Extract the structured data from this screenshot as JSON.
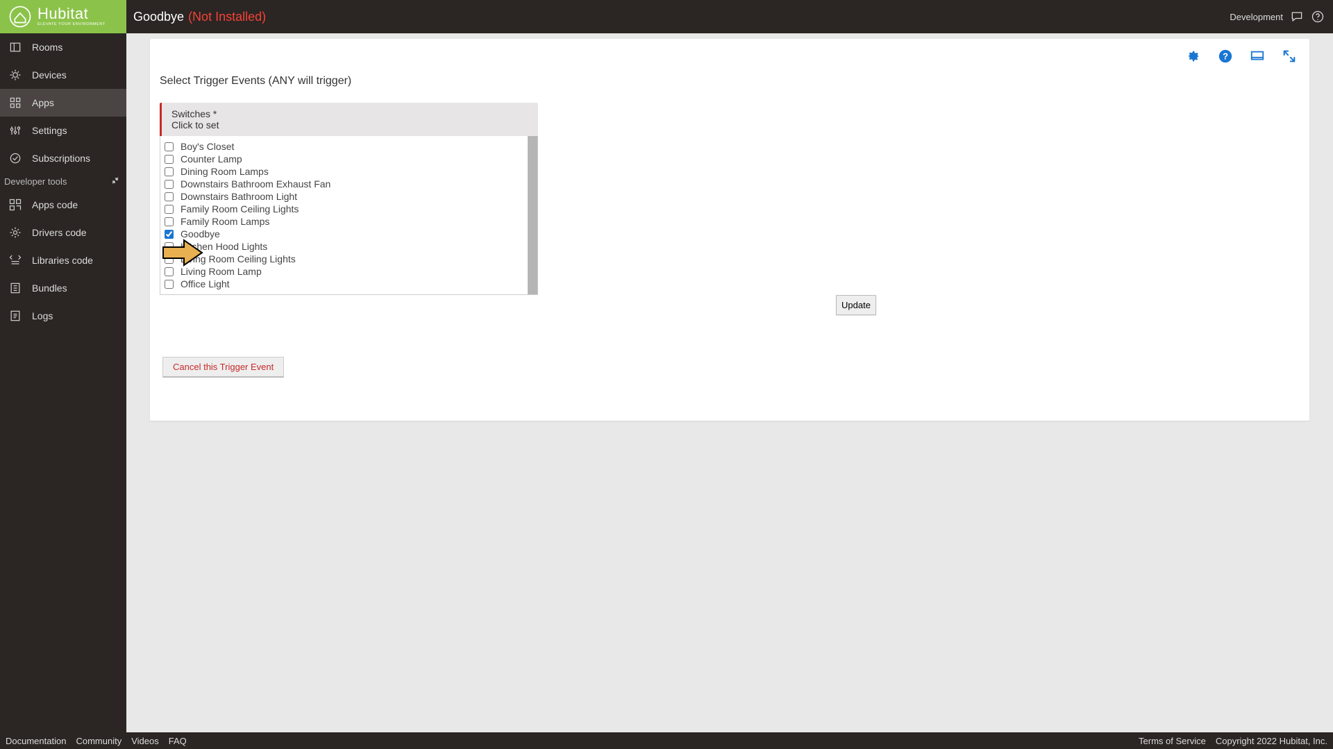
{
  "brand": {
    "name": "Hubitat",
    "tagline": "ELEVATE YOUR ENVIRONMENT"
  },
  "header": {
    "title": "Goodbye",
    "status": "(Not Installed)",
    "rightLabel": "Development"
  },
  "sidebar": {
    "items": [
      {
        "label": "Rooms"
      },
      {
        "label": "Devices"
      },
      {
        "label": "Apps"
      },
      {
        "label": "Settings"
      },
      {
        "label": "Subscriptions"
      }
    ],
    "devHeader": "Developer tools",
    "devItems": [
      {
        "label": "Apps code"
      },
      {
        "label": "Drivers code"
      },
      {
        "label": "Libraries code"
      },
      {
        "label": "Bundles"
      },
      {
        "label": "Logs"
      }
    ]
  },
  "main": {
    "sectionTitle": "Select Trigger Events (ANY will trigger)",
    "switchHead1": "Switches *",
    "switchHead2": "Click to set",
    "switchItems": [
      {
        "label": "Boy's Closet",
        "checked": false
      },
      {
        "label": "Counter Lamp",
        "checked": false
      },
      {
        "label": "Dining Room Lamps",
        "checked": false
      },
      {
        "label": "Downstairs Bathroom Exhaust Fan",
        "checked": false
      },
      {
        "label": "Downstairs Bathroom Light",
        "checked": false
      },
      {
        "label": "Family Room Ceiling Lights",
        "checked": false
      },
      {
        "label": "Family Room Lamps",
        "checked": false
      },
      {
        "label": "Goodbye",
        "checked": true
      },
      {
        "label": "Kitchen Hood Lights",
        "checked": false
      },
      {
        "label": "Living Room Ceiling Lights",
        "checked": false
      },
      {
        "label": "Living Room Lamp",
        "checked": false
      },
      {
        "label": "Office Light",
        "checked": false
      }
    ],
    "updateLabel": "Update",
    "cancelLabel": "Cancel this Trigger Event"
  },
  "footer": {
    "left": [
      "Documentation",
      "Community",
      "Videos",
      "FAQ"
    ],
    "right": [
      "Terms of Service",
      "Copyright 2022 Hubitat, Inc."
    ]
  }
}
